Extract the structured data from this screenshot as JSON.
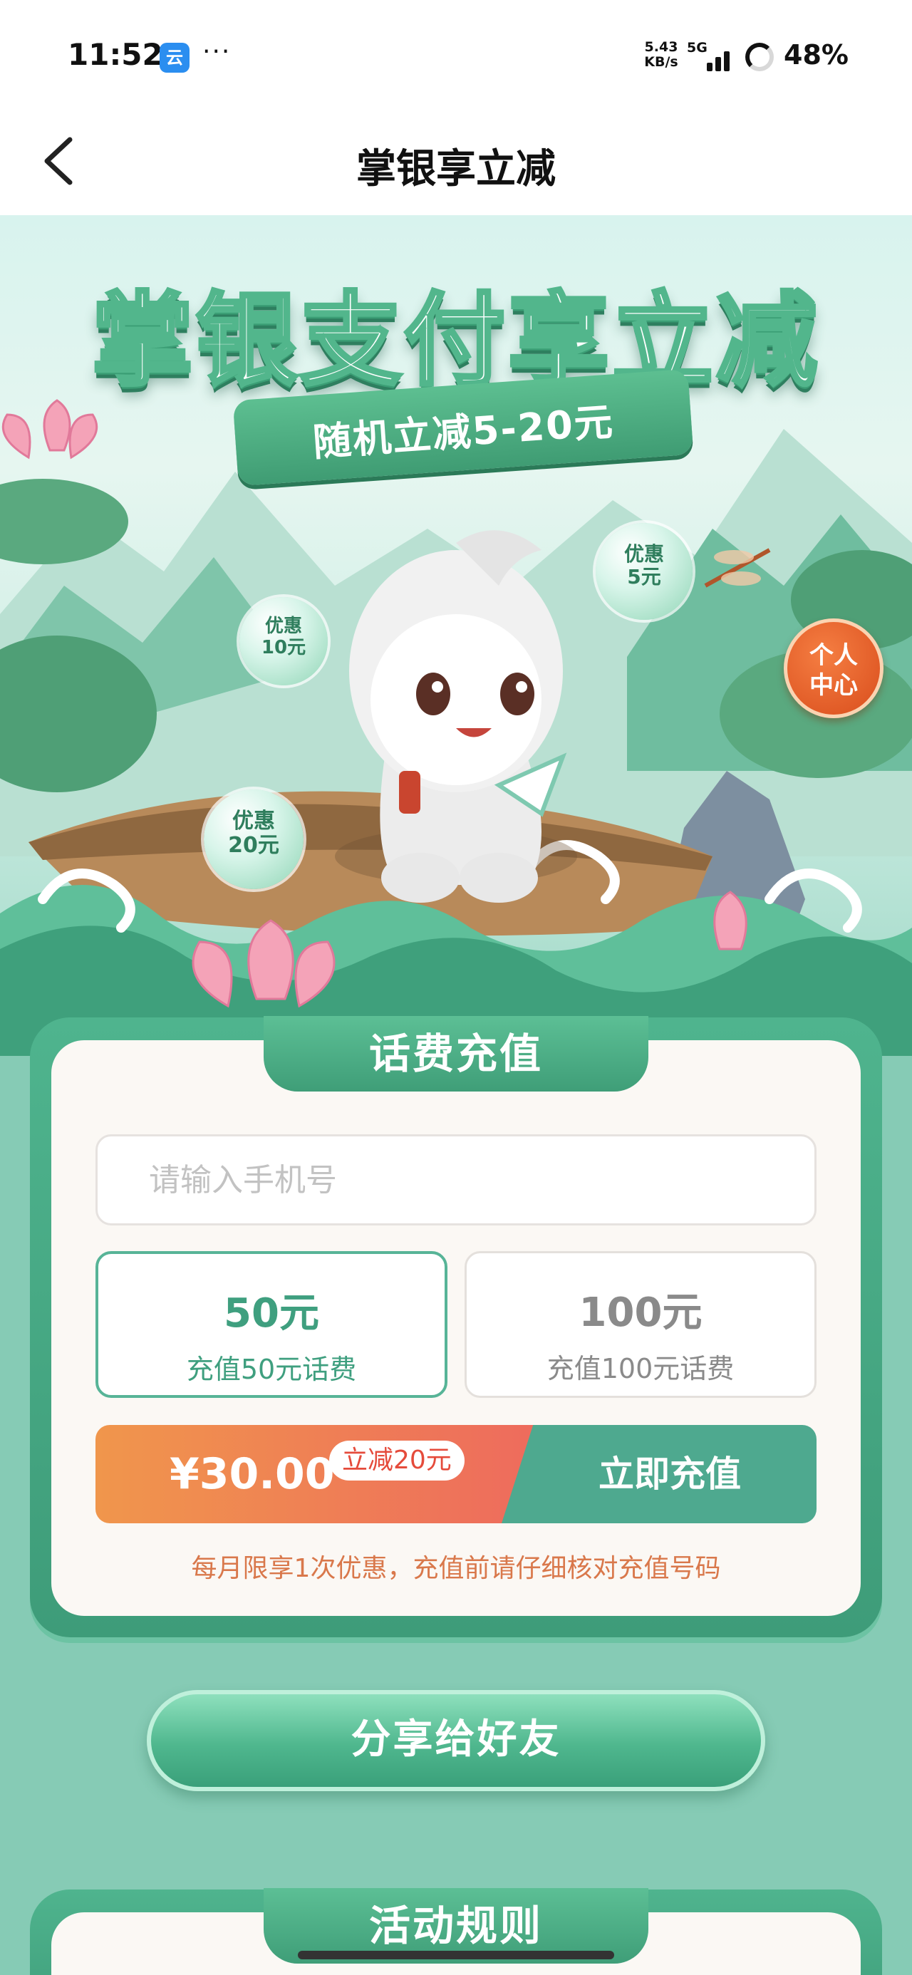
{
  "status_bar": {
    "time": "11:52",
    "app_icon_glyph": "云",
    "more_dots": "···",
    "net_speed_value": "5.43",
    "net_speed_unit": "KB/s",
    "network_type": "5G",
    "battery": "48%"
  },
  "nav": {
    "back_icon": "chevron-left-icon",
    "title": "掌银享立减"
  },
  "hero": {
    "title": "掌银支付享立减",
    "ribbon_text": "随机立减5-20元",
    "bubbles": [
      {
        "line1": "优惠",
        "line2": "10元"
      },
      {
        "line1": "优惠",
        "line2": "5元"
      },
      {
        "line1": "优惠",
        "line2": "20元"
      }
    ],
    "personal_center": {
      "line1": "个人",
      "line2": "中心"
    }
  },
  "recharge": {
    "title": "话费充值",
    "phone_placeholder": "请输入手机号",
    "options": [
      {
        "amount": "50元",
        "desc": "充值50元话费",
        "selected": true
      },
      {
        "amount": "100元",
        "desc": "充值100元话费",
        "selected": false
      }
    ],
    "price": "¥30.00",
    "discount_badge": "立减20元",
    "submit_label": "立即充值",
    "note": "每月限享1次优惠，充值前请仔细核对充值号码"
  },
  "share": {
    "label": "分享给好友"
  },
  "rules": {
    "title": "活动规则"
  },
  "colors": {
    "theme_green": "#4fb48e",
    "page_bg": "#86cbb5",
    "pay_orange": "#f0964c",
    "pay_red": "#ee6b5d",
    "pay_teal": "#4ea98f",
    "note_orange": "#d9784b"
  }
}
